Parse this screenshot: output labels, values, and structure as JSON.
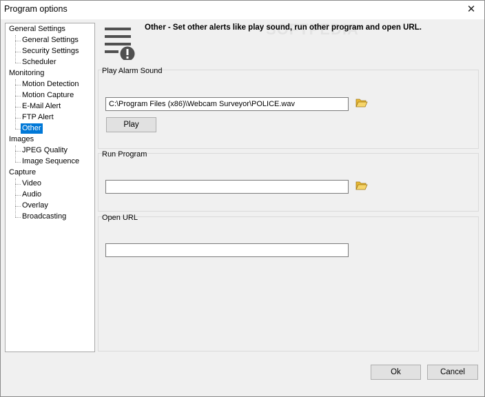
{
  "window": {
    "title": "Program options",
    "close_glyph": "✕"
  },
  "tree": {
    "groups": [
      {
        "label": "General Settings",
        "children": [
          "General Settings",
          "Security Settings",
          "Scheduler"
        ]
      },
      {
        "label": "Monitoring",
        "children": [
          "Motion Detection",
          "Motion Capture",
          "E-Mail Alert",
          "FTP Alert",
          "Other"
        ]
      },
      {
        "label": "Images",
        "children": [
          "JPEG Quality",
          "Image Sequence"
        ]
      },
      {
        "label": "Capture",
        "children": [
          "Video",
          "Audio",
          "Overlay",
          "Broadcasting"
        ]
      }
    ],
    "selected": "Other"
  },
  "header": {
    "icon": "alert-list-icon",
    "text": "Other - Set other alerts like play sound, run other program and open URL."
  },
  "watermark": "SOFTPEDIA",
  "play_alarm": {
    "label": "Play Alarm Sound",
    "path_value": "C:\\Program Files (x86)\\Webcam Surveyor\\POLICE.wav",
    "browse_icon": "folder-open-icon",
    "play_button": "Play"
  },
  "run_program": {
    "label": "Run Program",
    "path_value": "",
    "browse_icon": "folder-open-icon"
  },
  "open_url": {
    "label": "Open URL",
    "url_value": ""
  },
  "footer": {
    "ok": "Ok",
    "cancel": "Cancel"
  },
  "colors": {
    "selection": "#0078d7",
    "folder": "#e8b830"
  }
}
